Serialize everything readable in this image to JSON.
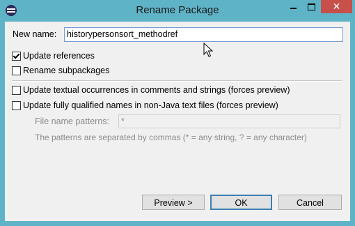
{
  "window": {
    "title": "Rename Package",
    "close_glyph": "✕"
  },
  "form": {
    "new_name_label": "New name:",
    "new_name_value": "historypersonsort_methodref",
    "options": {
      "update_references": {
        "label": "Update references",
        "checked": true
      },
      "rename_subpackages": {
        "label": "Rename subpackages",
        "checked": false
      },
      "update_textual": {
        "label": "Update textual occurrences in comments and strings (forces preview)",
        "checked": false
      },
      "update_qualified": {
        "label": "Update fully qualified names in non-Java text files (forces preview)",
        "checked": false
      }
    },
    "file_patterns_label": "File name patterns:",
    "file_patterns_value": "*",
    "patterns_hint": "The patterns are separated by commas (* = any string, ? = any character)"
  },
  "buttons": {
    "preview": "Preview >",
    "ok": "OK",
    "cancel": "Cancel"
  }
}
